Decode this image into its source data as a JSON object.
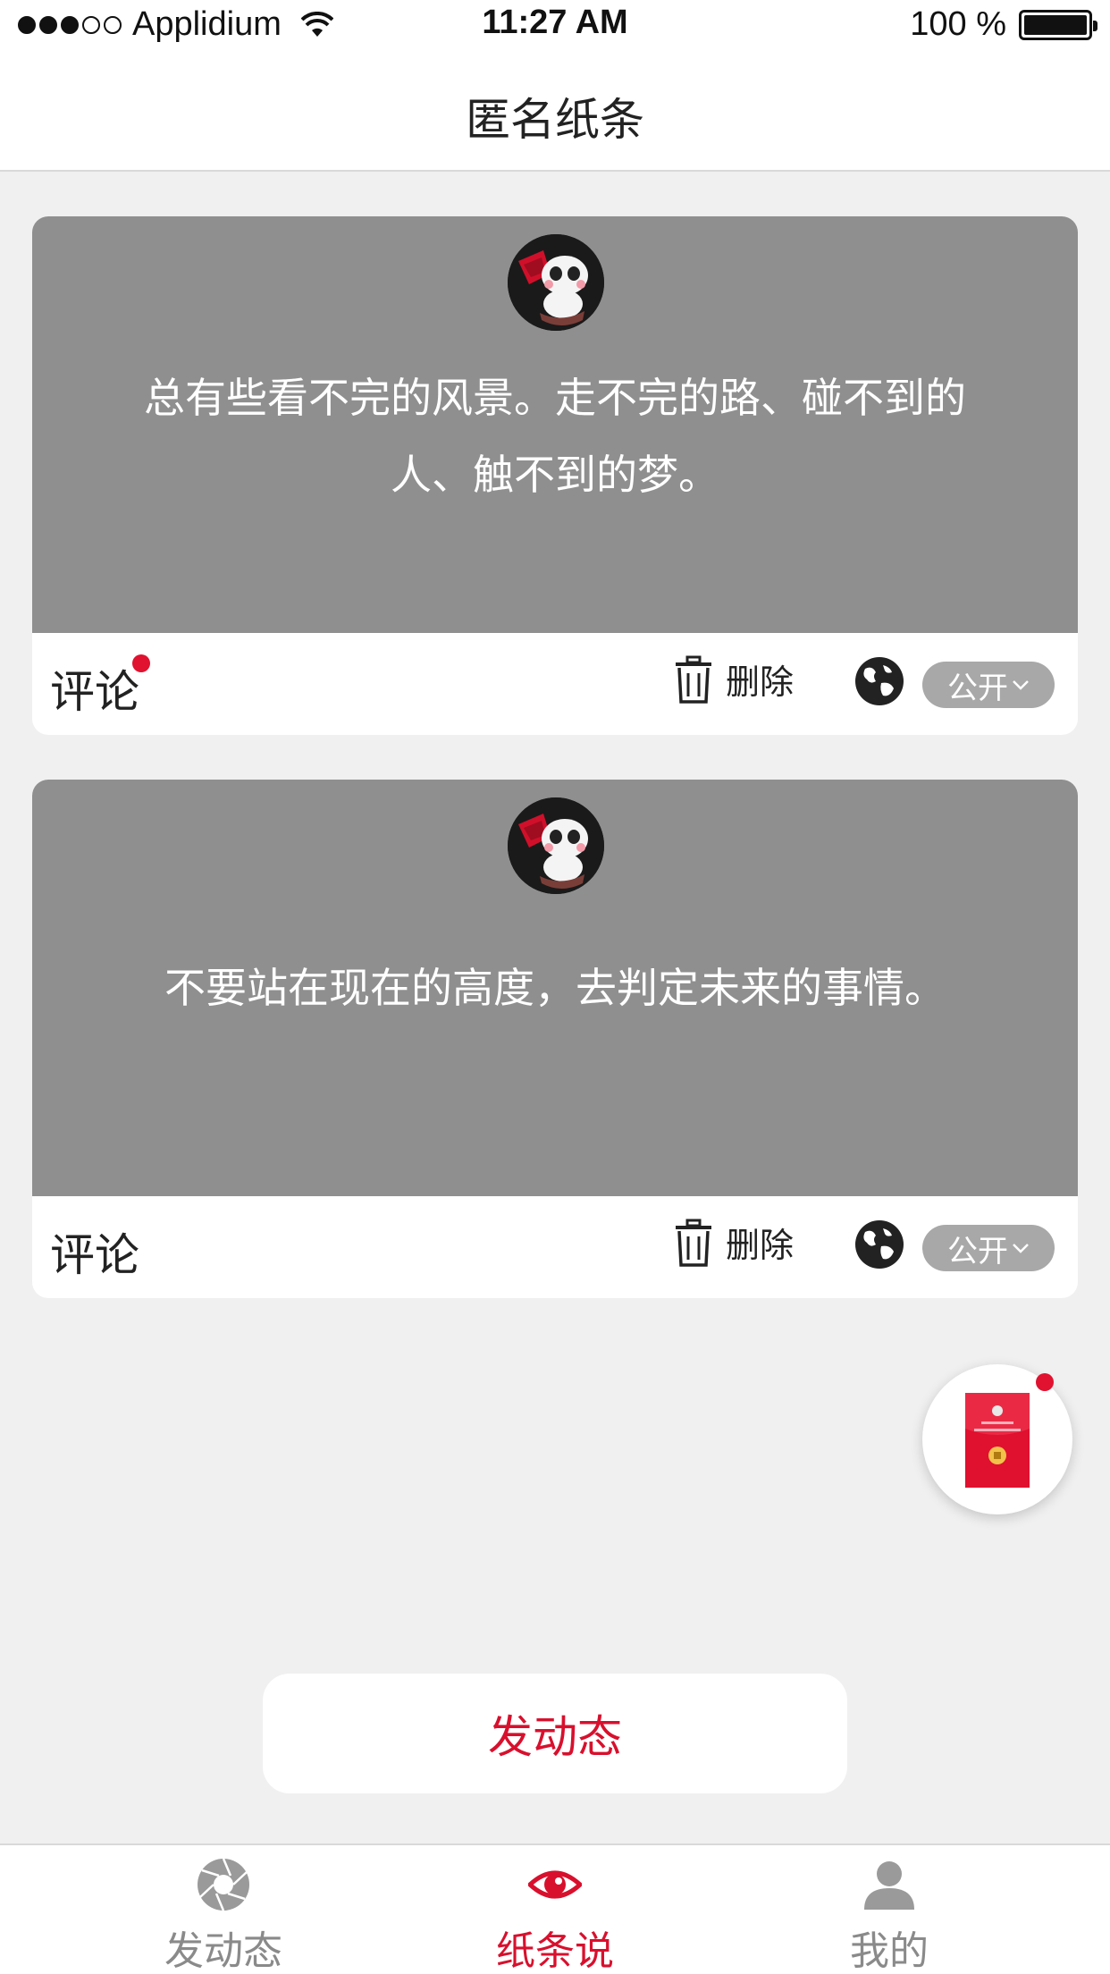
{
  "status_bar": {
    "carrier": "Applidium",
    "time": "11:27 AM",
    "battery": "100 %"
  },
  "nav": {
    "title": "匿名纸条"
  },
  "cards": [
    {
      "text": "总有些看不完的风景。走不完的路、碰不到的人、触不到的梦。",
      "comment_label": "评论",
      "has_unread": true,
      "delete_label": "删除",
      "visibility_label": "公开"
    },
    {
      "text": "不要站在现在的高度，去判定未来的事情。",
      "comment_label": "评论",
      "has_unread": false,
      "delete_label": "删除",
      "visibility_label": "公开"
    }
  ],
  "post_button": {
    "label": "发动态"
  },
  "tabs": [
    {
      "label": "发动态",
      "icon": "aperture-icon",
      "active": false
    },
    {
      "label": "纸条说",
      "icon": "eye-icon",
      "active": true
    },
    {
      "label": "我的",
      "icon": "user-icon",
      "active": false
    }
  ],
  "colors": {
    "accent": "#d8102d",
    "card_body": "#8f8f8f",
    "background": "#f0f0f0",
    "unread_dot": "#e0122f"
  }
}
